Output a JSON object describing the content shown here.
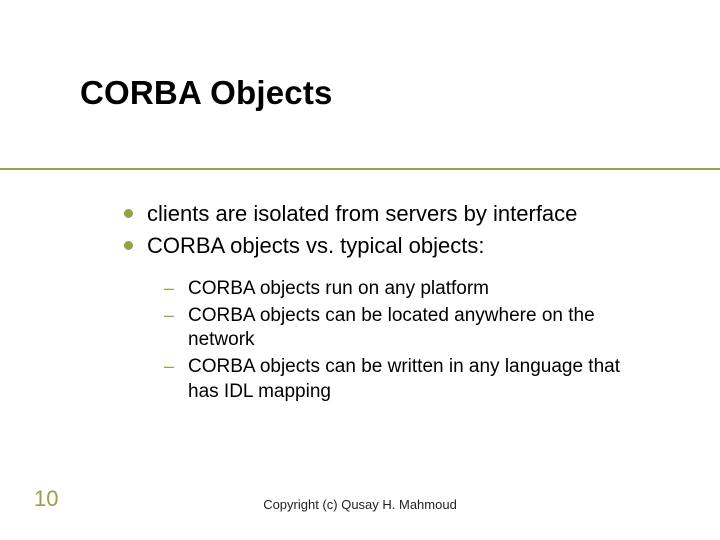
{
  "title": "CORBA Objects",
  "bullets": {
    "b1": "clients are isolated from servers by interface",
    "b2": "CORBA objects vs. typical objects:"
  },
  "sub_bullets": {
    "s1": "CORBA objects run on any platform",
    "s2": "CORBA objects can be located anywhere on the network",
    "s3": "CORBA objects can be written in any language that has IDL mapping"
  },
  "page_number": "10",
  "copyright": "Copyright (c) Qusay H. Mahmoud"
}
